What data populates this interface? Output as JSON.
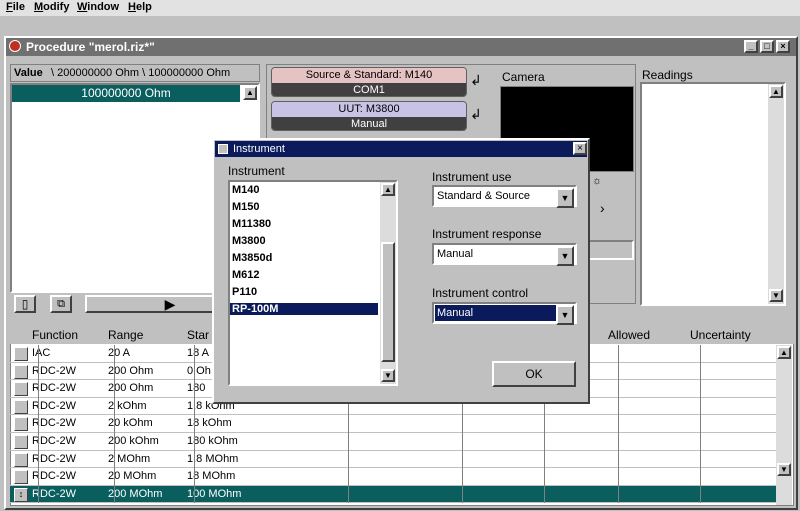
{
  "menu": [
    "File",
    "Modify",
    "Window",
    "Help"
  ],
  "window": {
    "title": "Procedure \"merol.riz*\"",
    "controls": [
      "minimize-icon",
      "maximize-icon",
      "close-icon"
    ]
  },
  "value_panel": {
    "header_label": "Value",
    "header_text": "\\ 200000000 Ohm \\ 100000000 Ohm",
    "selected_value": "100000000 Ohm"
  },
  "instruments": {
    "source_title": "Source & Standard: M140",
    "source_sub": "COM1",
    "uut_title": "UUT: M3800",
    "uut_sub": "Manual"
  },
  "camera": {
    "label": "Camera"
  },
  "readings": {
    "label": "Readings"
  },
  "toolbar": {
    "icons": [
      "new-doc-icon",
      "copy-icon",
      "play-icon"
    ]
  },
  "grid": {
    "headers": [
      "Function",
      "Range",
      "Star",
      "Allowed",
      "Uncertainty"
    ],
    "rows": [
      {
        "function": "IAC",
        "range": "20 A",
        "standard": "18 A"
      },
      {
        "function": "RDC-2W",
        "range": "200 Ohm",
        "standard": "0 Oh"
      },
      {
        "function": "RDC-2W",
        "range": "200 Ohm",
        "standard": "180"
      },
      {
        "function": "RDC-2W",
        "range": "2 kOhm",
        "standard": "1.8 kOhm"
      },
      {
        "function": "RDC-2W",
        "range": "20 kOhm",
        "standard": "18 kOhm"
      },
      {
        "function": "RDC-2W",
        "range": "200 kOhm",
        "standard": "180 kOhm"
      },
      {
        "function": "RDC-2W",
        "range": "2 MOhm",
        "standard": "1.8 MOhm"
      },
      {
        "function": "RDC-2W",
        "range": "20 MOhm",
        "standard": "18 MOhm"
      },
      {
        "function": "RDC-2W",
        "range": "200 MOhm",
        "standard": "100 MOhm"
      }
    ]
  },
  "dialog": {
    "title": "Instrument",
    "list_label": "Instrument",
    "items": [
      "M140",
      "M150",
      "M11380",
      "M3800",
      "M3850d",
      "M612",
      "P110",
      "RP-100M"
    ],
    "selected": "RP-100M",
    "use_label": "Instrument use",
    "use_value": "Standard & Source",
    "response_label": "Instrument response",
    "response_value": "Manual",
    "control_label": "Instrument control",
    "control_value": "Manual",
    "ok_label": "OK"
  },
  "colors": {
    "teal": "#0b5e5e",
    "navy": "#0a1a5a",
    "source_pink": "#e6c3c3",
    "uut_lavender": "#c8c3e6"
  }
}
